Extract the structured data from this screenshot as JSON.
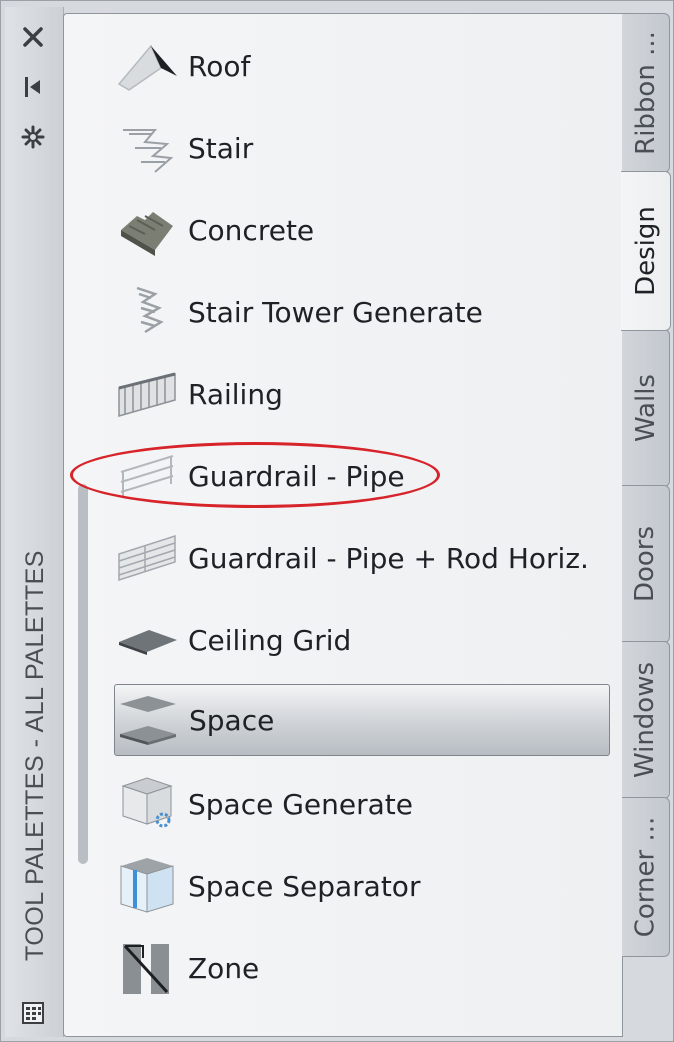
{
  "window": {
    "title": "TOOL PALETTES - ALL PALETTES"
  },
  "strip_icons": [
    "close-icon",
    "auto-hide-icon",
    "properties-icon",
    "palette-menu-icon"
  ],
  "tools": [
    {
      "label": "Roof",
      "icon": "roof-icon"
    },
    {
      "label": "Stair",
      "icon": "stair-icon"
    },
    {
      "label": "Concrete",
      "icon": "concrete-stair-icon"
    },
    {
      "label": "Stair Tower Generate",
      "icon": "stair-tower-icon"
    },
    {
      "label": "Railing",
      "icon": "railing-icon"
    },
    {
      "label": "Guardrail - Pipe",
      "icon": "guardrail-pipe-icon"
    },
    {
      "label": "Guardrail - Pipe + Rod Horiz.",
      "icon": "guardrail-rod-icon"
    },
    {
      "label": "Ceiling Grid",
      "icon": "ceiling-grid-icon"
    },
    {
      "label": "Space",
      "icon": "space-icon",
      "selected": true
    },
    {
      "label": "Space Generate",
      "icon": "space-generate-icon"
    },
    {
      "label": "Space Separator",
      "icon": "space-separator-icon"
    },
    {
      "label": "Zone",
      "icon": "zone-icon"
    }
  ],
  "tabs": [
    {
      "label": "Ribbon ...",
      "active": false
    },
    {
      "label": "Design",
      "active": true
    },
    {
      "label": "Walls",
      "active": false
    },
    {
      "label": "Doors",
      "active": false
    },
    {
      "label": "Windows",
      "active": false
    },
    {
      "label": "Corner ...",
      "active": false
    }
  ],
  "colors": {
    "highlight_ellipse": "#d7232a",
    "panel_bg": "#f4f5f6",
    "selected_item": "#c3c8ce"
  }
}
